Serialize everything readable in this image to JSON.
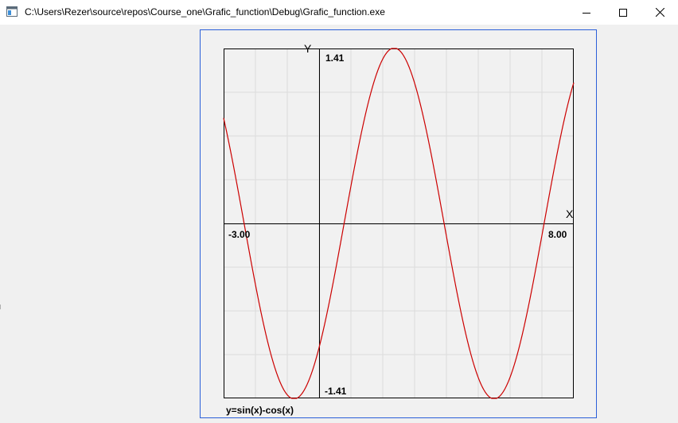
{
  "window": {
    "title": "C:\\Users\\Rezer\\source\\repos\\Course_one\\Grafic_function\\Debug\\Grafic_function.exe",
    "icon": "console-app-icon",
    "controls": [
      "minimize-icon",
      "maximize-icon",
      "close-icon"
    ]
  },
  "graph": {
    "y_axis_label": "Y",
    "x_axis_label": "X",
    "y_max_label": "1.41",
    "y_min_label": "-1.41",
    "x_min_label": "-3.00",
    "x_max_label": "8.00",
    "formula": "y=sin(x)-cos(x)",
    "curve_color": "#cc0000",
    "frame_color": "#2b5fd9",
    "grid": true
  },
  "chart_data": {
    "type": "line",
    "series": [
      {
        "name": "y=sin(x)-cos(x)",
        "function": "sin(x)-cos(x)"
      }
    ],
    "xlim": [
      -3.0,
      8.0
    ],
    "ylim": [
      -1.41,
      1.41
    ],
    "xticks": [
      "-3.00",
      "8.00"
    ],
    "yticks": [
      "1.41",
      "-1.41"
    ],
    "xlabel": "X",
    "ylabel": "Y",
    "title": "y=sin(x)-cos(x)",
    "grid": true
  }
}
